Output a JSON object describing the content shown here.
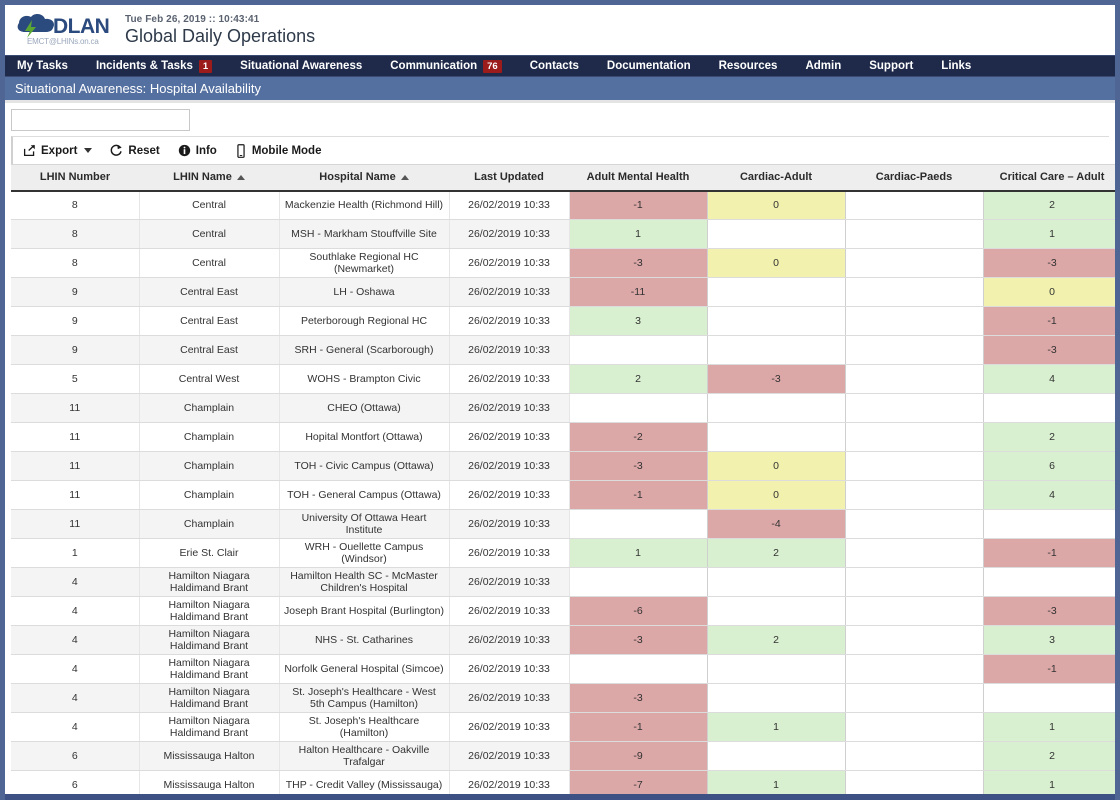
{
  "brand": {
    "name": "DLAN",
    "subtitle": "EMCT@LHINs.on.ca",
    "logo_icon": "cloud-lightning-icon"
  },
  "header": {
    "datetime": "Tue Feb 26, 2019 :: 10:43:41",
    "title": "Global Daily Operations"
  },
  "nav": {
    "items": [
      {
        "label": "My Tasks",
        "badge": null
      },
      {
        "label": "Incidents & Tasks",
        "badge": "1"
      },
      {
        "label": "Situational Awareness",
        "badge": null
      },
      {
        "label": "Communication",
        "badge": "76"
      },
      {
        "label": "Contacts",
        "badge": null
      },
      {
        "label": "Documentation",
        "badge": null
      },
      {
        "label": "Resources",
        "badge": null
      },
      {
        "label": "Admin",
        "badge": null
      },
      {
        "label": "Support",
        "badge": null
      },
      {
        "label": "Links",
        "badge": null
      }
    ]
  },
  "page": {
    "title": "Situational Awareness: Hospital Availability",
    "filter_value": "",
    "filter_placeholder": ""
  },
  "toolbar": {
    "export_label": "Export",
    "export_icon": "export-box-arrow-icon",
    "reset_label": "Reset",
    "reset_icon": "refresh-circle-arrow-icon",
    "info_label": "Info",
    "info_icon": "info-circle-icon",
    "mobile_label": "Mobile Mode",
    "mobile_icon": "mobile-phone-icon"
  },
  "colors": {
    "nav_background": "#1f2a4a",
    "page_title_background": "#5470a0",
    "frame_background": "#4f6593",
    "badge": "#9c1c1c",
    "cell_red": "#dca7a7",
    "cell_green": "#d8efd0",
    "cell_yellow": "#f2f2ae",
    "brand_blue": "#2b4a7e",
    "brand_green": "#5aa832"
  },
  "table": {
    "columns": [
      {
        "label": "LHIN Number",
        "sort": null
      },
      {
        "label": "LHIN Name",
        "sort": "asc"
      },
      {
        "label": "Hospital Name",
        "sort": "asc"
      },
      {
        "label": "Last Updated",
        "sort": null
      },
      {
        "label": "Adult Mental Health",
        "sort": null
      },
      {
        "label": "Cardiac-Adult",
        "sort": null
      },
      {
        "label": "Cardiac-Paeds",
        "sort": null
      },
      {
        "label": "Critical Care – Adult",
        "sort": null
      }
    ],
    "rows": [
      {
        "lhin_number": "8",
        "lhin_name": "Central",
        "hospital": "Mackenzie Health (Richmond Hill)",
        "updated": "26/02/2019 10:33",
        "amh": "-1",
        "amh_c": "red",
        "ca": "0",
        "ca_c": "yellow",
        "cp": "",
        "cp_c": "none",
        "cca": "2",
        "cca_c": "green"
      },
      {
        "lhin_number": "8",
        "lhin_name": "Central",
        "hospital": "MSH - Markham Stouffville Site",
        "updated": "26/02/2019 10:33",
        "amh": "1",
        "amh_c": "green",
        "ca": "",
        "ca_c": "none",
        "cp": "",
        "cp_c": "none",
        "cca": "1",
        "cca_c": "green"
      },
      {
        "lhin_number": "8",
        "lhin_name": "Central",
        "hospital": "Southlake Regional HC (Newmarket)",
        "updated": "26/02/2019 10:33",
        "amh": "-3",
        "amh_c": "red",
        "ca": "0",
        "ca_c": "yellow",
        "cp": "",
        "cp_c": "none",
        "cca": "-3",
        "cca_c": "red"
      },
      {
        "lhin_number": "9",
        "lhin_name": "Central East",
        "hospital": "LH - Oshawa",
        "updated": "26/02/2019 10:33",
        "amh": "-11",
        "amh_c": "red",
        "ca": "",
        "ca_c": "none",
        "cp": "",
        "cp_c": "none",
        "cca": "0",
        "cca_c": "yellow"
      },
      {
        "lhin_number": "9",
        "lhin_name": "Central East",
        "hospital": "Peterborough Regional HC",
        "updated": "26/02/2019 10:33",
        "amh": "3",
        "amh_c": "green",
        "ca": "",
        "ca_c": "none",
        "cp": "",
        "cp_c": "none",
        "cca": "-1",
        "cca_c": "red"
      },
      {
        "lhin_number": "9",
        "lhin_name": "Central East",
        "hospital": "SRH - General (Scarborough)",
        "updated": "26/02/2019 10:33",
        "amh": "",
        "amh_c": "none",
        "ca": "",
        "ca_c": "none",
        "cp": "",
        "cp_c": "none",
        "cca": "-3",
        "cca_c": "red"
      },
      {
        "lhin_number": "5",
        "lhin_name": "Central West",
        "hospital": "WOHS - Brampton Civic",
        "updated": "26/02/2019 10:33",
        "amh": "2",
        "amh_c": "green",
        "ca": "-3",
        "ca_c": "red",
        "cp": "",
        "cp_c": "none",
        "cca": "4",
        "cca_c": "green"
      },
      {
        "lhin_number": "11",
        "lhin_name": "Champlain",
        "hospital": "CHEO (Ottawa)",
        "updated": "26/02/2019 10:33",
        "amh": "",
        "amh_c": "none",
        "ca": "",
        "ca_c": "none",
        "cp": "",
        "cp_c": "none",
        "cca": "",
        "cca_c": "none"
      },
      {
        "lhin_number": "11",
        "lhin_name": "Champlain",
        "hospital": "Hopital Montfort (Ottawa)",
        "updated": "26/02/2019 10:33",
        "amh": "-2",
        "amh_c": "red",
        "ca": "",
        "ca_c": "none",
        "cp": "",
        "cp_c": "none",
        "cca": "2",
        "cca_c": "green"
      },
      {
        "lhin_number": "11",
        "lhin_name": "Champlain",
        "hospital": "TOH - Civic Campus (Ottawa)",
        "updated": "26/02/2019 10:33",
        "amh": "-3",
        "amh_c": "red",
        "ca": "0",
        "ca_c": "yellow",
        "cp": "",
        "cp_c": "none",
        "cca": "6",
        "cca_c": "green"
      },
      {
        "lhin_number": "11",
        "lhin_name": "Champlain",
        "hospital": "TOH - General Campus (Ottawa)",
        "updated": "26/02/2019 10:33",
        "amh": "-1",
        "amh_c": "red",
        "ca": "0",
        "ca_c": "yellow",
        "cp": "",
        "cp_c": "none",
        "cca": "4",
        "cca_c": "green"
      },
      {
        "lhin_number": "11",
        "lhin_name": "Champlain",
        "hospital": "University Of Ottawa Heart Institute",
        "updated": "26/02/2019 10:33",
        "amh": "",
        "amh_c": "none",
        "ca": "-4",
        "ca_c": "red",
        "cp": "",
        "cp_c": "none",
        "cca": "",
        "cca_c": "none"
      },
      {
        "lhin_number": "1",
        "lhin_name": "Erie St. Clair",
        "hospital": "WRH - Ouellette Campus (Windsor)",
        "updated": "26/02/2019 10:33",
        "amh": "1",
        "amh_c": "green",
        "ca": "2",
        "ca_c": "green",
        "cp": "",
        "cp_c": "none",
        "cca": "-1",
        "cca_c": "red"
      },
      {
        "lhin_number": "4",
        "lhin_name": "Hamilton Niagara Haldimand Brant",
        "hospital": "Hamilton Health SC - McMaster Children's Hospital",
        "updated": "26/02/2019 10:33",
        "amh": "",
        "amh_c": "none",
        "ca": "",
        "ca_c": "none",
        "cp": "",
        "cp_c": "none",
        "cca": "",
        "cca_c": "none"
      },
      {
        "lhin_number": "4",
        "lhin_name": "Hamilton Niagara Haldimand Brant",
        "hospital": "Joseph Brant Hospital (Burlington)",
        "updated": "26/02/2019 10:33",
        "amh": "-6",
        "amh_c": "red",
        "ca": "",
        "ca_c": "none",
        "cp": "",
        "cp_c": "none",
        "cca": "-3",
        "cca_c": "red"
      },
      {
        "lhin_number": "4",
        "lhin_name": "Hamilton Niagara Haldimand Brant",
        "hospital": "NHS - St. Catharines",
        "updated": "26/02/2019 10:33",
        "amh": "-3",
        "amh_c": "red",
        "ca": "2",
        "ca_c": "green",
        "cp": "",
        "cp_c": "none",
        "cca": "3",
        "cca_c": "green"
      },
      {
        "lhin_number": "4",
        "lhin_name": "Hamilton Niagara Haldimand Brant",
        "hospital": "Norfolk General Hospital (Simcoe)",
        "updated": "26/02/2019 10:33",
        "amh": "",
        "amh_c": "none",
        "ca": "",
        "ca_c": "none",
        "cp": "",
        "cp_c": "none",
        "cca": "-1",
        "cca_c": "red"
      },
      {
        "lhin_number": "4",
        "lhin_name": "Hamilton Niagara Haldimand Brant",
        "hospital": "St. Joseph's Healthcare - West 5th Campus (Hamilton)",
        "updated": "26/02/2019 10:33",
        "amh": "-3",
        "amh_c": "red",
        "ca": "",
        "ca_c": "none",
        "cp": "",
        "cp_c": "none",
        "cca": "",
        "cca_c": "none"
      },
      {
        "lhin_number": "4",
        "lhin_name": "Hamilton Niagara Haldimand Brant",
        "hospital": "St. Joseph's Healthcare (Hamilton)",
        "updated": "26/02/2019 10:33",
        "amh": "-1",
        "amh_c": "red",
        "ca": "1",
        "ca_c": "green",
        "cp": "",
        "cp_c": "none",
        "cca": "1",
        "cca_c": "green"
      },
      {
        "lhin_number": "6",
        "lhin_name": "Mississauga Halton",
        "hospital": "Halton Healthcare - Oakville Trafalgar",
        "updated": "26/02/2019 10:33",
        "amh": "-9",
        "amh_c": "red",
        "ca": "",
        "ca_c": "none",
        "cp": "",
        "cp_c": "none",
        "cca": "2",
        "cca_c": "green"
      },
      {
        "lhin_number": "6",
        "lhin_name": "Mississauga Halton",
        "hospital": "THP - Credit Valley (Mississauga)",
        "updated": "26/02/2019 10:33",
        "amh": "-7",
        "amh_c": "red",
        "ca": "1",
        "ca_c": "green",
        "cp": "",
        "cp_c": "none",
        "cca": "1",
        "cca_c": "green"
      }
    ]
  }
}
